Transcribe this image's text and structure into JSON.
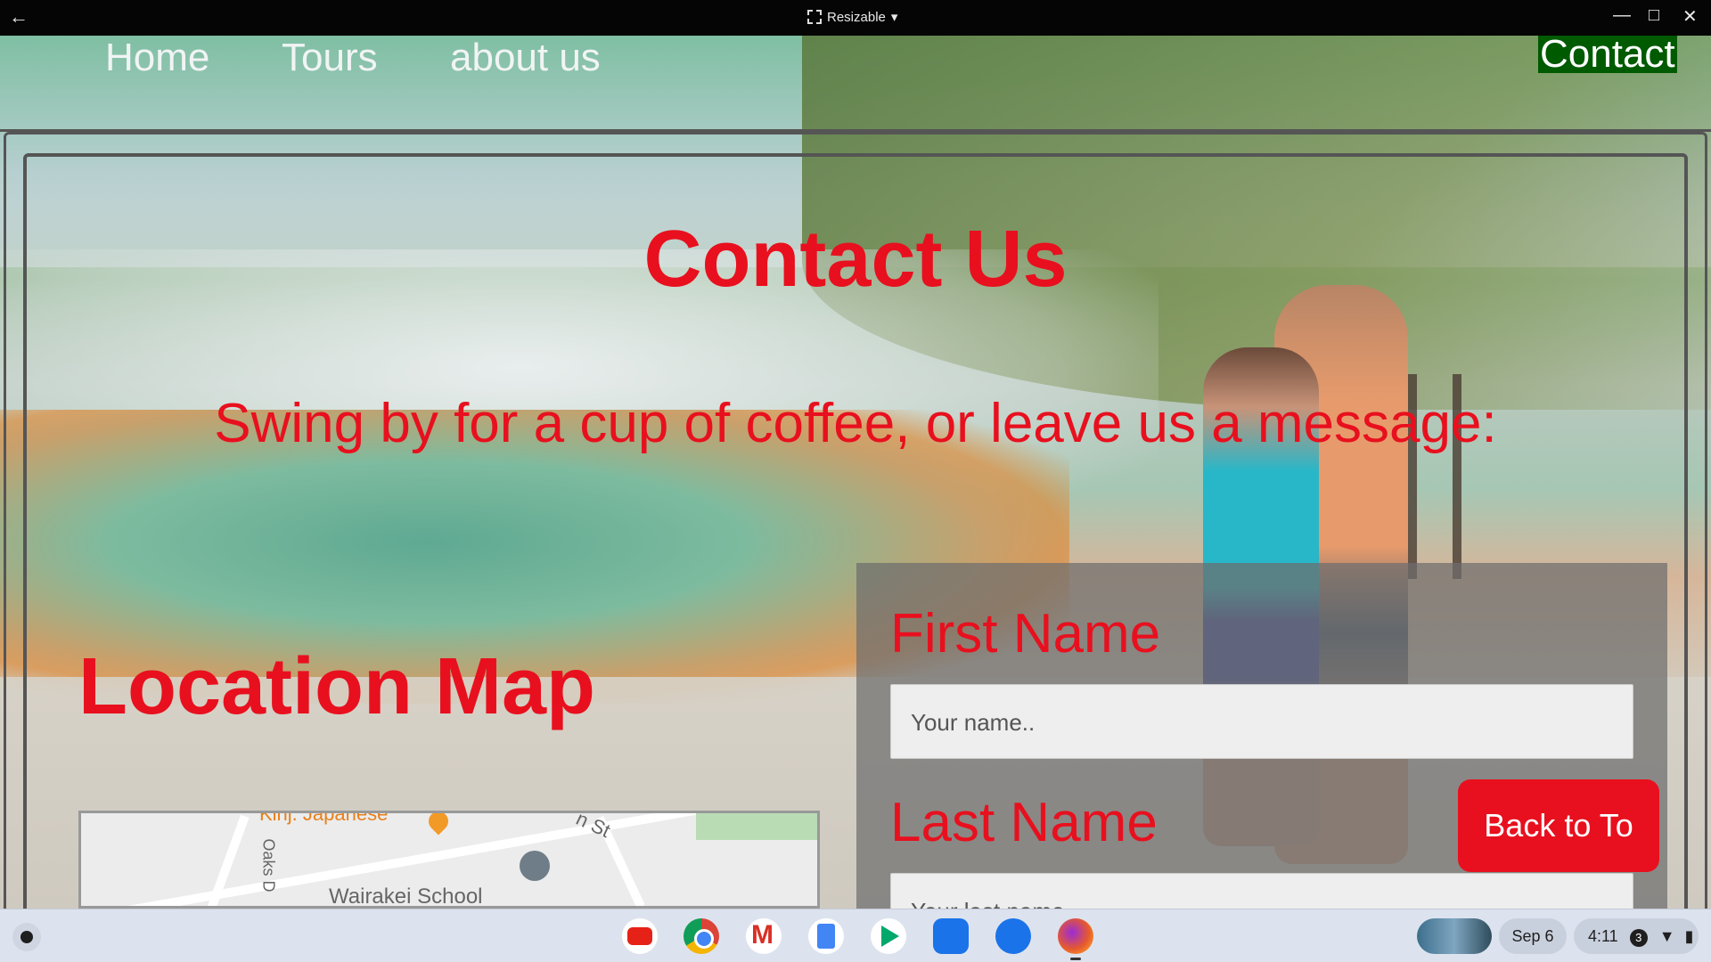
{
  "window": {
    "back_icon": "arrow-left-icon",
    "mode_label": "Resizable",
    "controls": [
      "minimize-icon",
      "maximize-icon",
      "close-icon"
    ]
  },
  "nav": {
    "home": "Home",
    "tours": "Tours",
    "about": "about us",
    "contact": "Contact",
    "accent": "#005a00"
  },
  "main": {
    "heading": "Contact Us",
    "subheading": "Swing by for a cup of coffee, or leave us a message:",
    "location_title": "Location Map",
    "heading_color": "#e8101e"
  },
  "map": {
    "label_restaurant": "Kinj. Japanese",
    "label_school": "Wairakei School",
    "label_street1": "Oaks D",
    "label_street2": "n St"
  },
  "form": {
    "first_name_label": "First Name",
    "first_name_placeholder": "Your name..",
    "last_name_label": "Last Name",
    "last_name_placeholder": "Your last name.."
  },
  "back_to_top": "Back to To",
  "shelf": {
    "apps": [
      "youtube-icon",
      "chrome-icon",
      "gmail-icon",
      "docs-icon",
      "play-store-icon",
      "files-icon",
      "messages-icon",
      "firefox-icon"
    ],
    "date": "Sep 6",
    "time": "4:11",
    "notification_count": "3"
  }
}
